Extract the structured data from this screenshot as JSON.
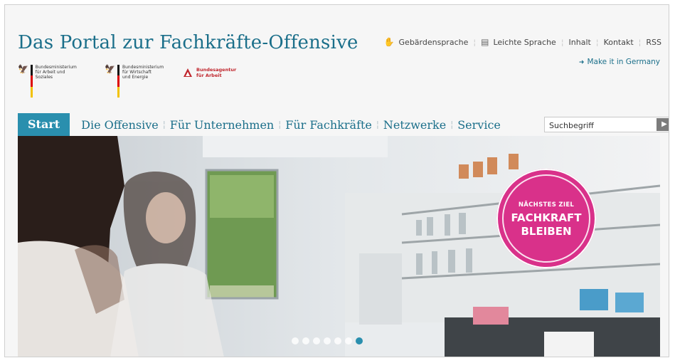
{
  "header": {
    "title": "Das Portal zur Fachkräfte-Offensive",
    "logos": [
      {
        "icon": "eagle-icon",
        "text": "Bundesministerium\nfür Arbeit und Soziales"
      },
      {
        "icon": "eagle-icon",
        "text": "Bundesministerium\nfür Wirtschaft\nund Energie"
      },
      {
        "icon": "arbeitsagentur-logo",
        "text": "Bundesagentur\nfür Arbeit"
      }
    ]
  },
  "topnav": {
    "items": [
      {
        "label": "Gebärdensprache",
        "icon": "sign-language-icon"
      },
      {
        "label": "Leichte Sprache",
        "icon": "easy-language-icon"
      },
      {
        "label": "Inhalt"
      },
      {
        "label": "Kontakt"
      },
      {
        "label": "RSS"
      }
    ],
    "make_it_in_germany": "Make it in Germany"
  },
  "mainnav": {
    "items": [
      {
        "label": "Start",
        "active": true
      },
      {
        "label": "Die Offensive"
      },
      {
        "label": "Für Unternehmen"
      },
      {
        "label": "Für Fachkräfte"
      },
      {
        "label": "Netzwerke"
      },
      {
        "label": "Service"
      }
    ],
    "search": {
      "placeholder": "Suchbegriff",
      "button_icon": "chevron-right-icon"
    }
  },
  "hero": {
    "badge": {
      "line1": "NÄCHSTES ZIEL",
      "line2": "FACHKRAFT\nBLEIBEN"
    },
    "slides_total": 7,
    "active_slide": 7
  },
  "colors": {
    "accent": "#1b6f8a",
    "nav_active": "#2a8fae",
    "badge": "#d9318a"
  }
}
